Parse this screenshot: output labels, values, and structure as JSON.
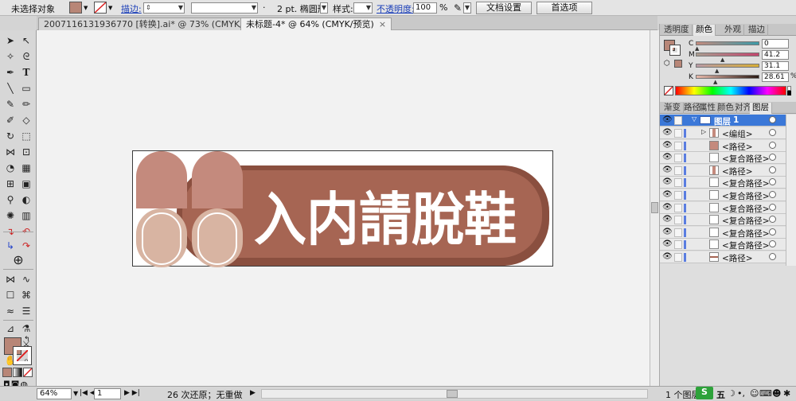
{
  "control_bar": {
    "selection_label": "未选择对象",
    "stroke_label": "描边:",
    "stroke_weight": "2 pt. 椭圆形",
    "stroke_weight_prefix": "·",
    "style_label": "样式:",
    "opacity_label": "不透明度:",
    "opacity_value": "100",
    "percent": "%",
    "doc_settings_button": "文档设置",
    "preferences_button": "首选项",
    "fill_color": "#b88677"
  },
  "tabs": [
    {
      "label": "2007116131936770 [转换].ai* @ 73% (CMYK/预览)",
      "close": "×"
    },
    {
      "label": "未标题-4* @ 64% (CMYK/预览)",
      "close": "×"
    }
  ],
  "artwork": {
    "text": "入内請脫鞋",
    "colors": {
      "plate": "#a66553",
      "plate_dark": "#8a4f3f",
      "slipper_top": "#c48a7d",
      "slipper_bottom": "#d8b4a2",
      "text": "#ffffff"
    }
  },
  "color_panel": {
    "tabs": [
      "透明度",
      "颜色",
      "外观",
      "描边"
    ],
    "channels": [
      {
        "label": "C",
        "value": "0",
        "unit": ""
      },
      {
        "label": "M",
        "value": "41.2",
        "unit": ""
      },
      {
        "label": "Y",
        "value": "31.1",
        "unit": ""
      },
      {
        "label": "K",
        "value": "28.61",
        "unit": "%"
      }
    ]
  },
  "layers_panel": {
    "tabs": [
      "渐变",
      "路径",
      "属性",
      "颜色",
      "对齐",
      "图层"
    ],
    "top_layer": {
      "name": "图层",
      "number": "1"
    },
    "rows": [
      "<编组>",
      "<路径>",
      "<复合路径>",
      "<路径>",
      "<复合路径>",
      "<复合路径>",
      "<复合路径>",
      "<复合路径>",
      "<复合路径>",
      "<复合路径>",
      "<路径>"
    ],
    "footer": "1 个图层"
  },
  "status_bar": {
    "zoom": "64%",
    "page": "1",
    "undo_text": "26 次还原；无重做",
    "ime_text": "五"
  }
}
